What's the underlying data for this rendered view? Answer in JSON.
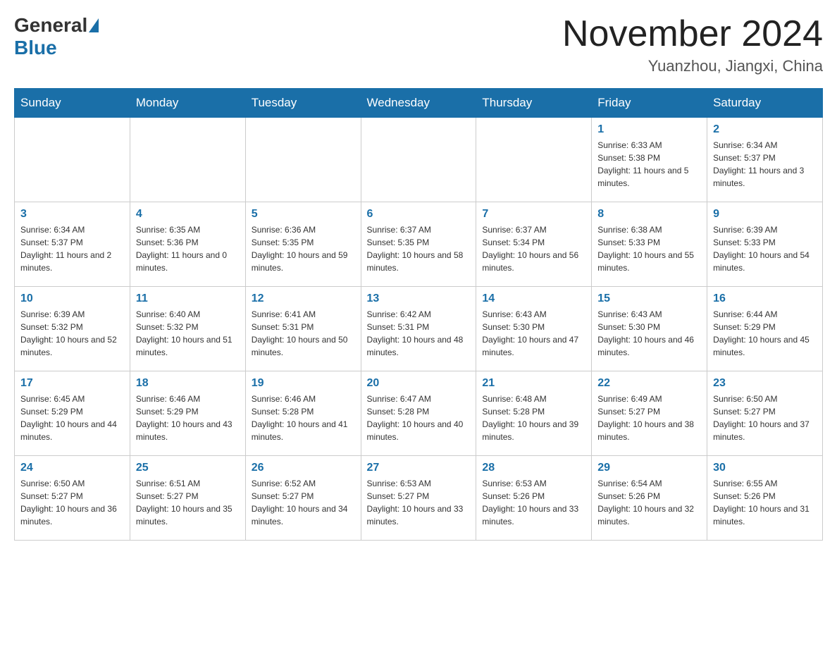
{
  "header": {
    "logo_general": "General",
    "logo_blue": "Blue",
    "month_title": "November 2024",
    "location": "Yuanzhou, Jiangxi, China"
  },
  "days_of_week": [
    "Sunday",
    "Monday",
    "Tuesday",
    "Wednesday",
    "Thursday",
    "Friday",
    "Saturday"
  ],
  "weeks": [
    [
      {
        "day": "",
        "info": ""
      },
      {
        "day": "",
        "info": ""
      },
      {
        "day": "",
        "info": ""
      },
      {
        "day": "",
        "info": ""
      },
      {
        "day": "",
        "info": ""
      },
      {
        "day": "1",
        "info": "Sunrise: 6:33 AM\nSunset: 5:38 PM\nDaylight: 11 hours and 5 minutes."
      },
      {
        "day": "2",
        "info": "Sunrise: 6:34 AM\nSunset: 5:37 PM\nDaylight: 11 hours and 3 minutes."
      }
    ],
    [
      {
        "day": "3",
        "info": "Sunrise: 6:34 AM\nSunset: 5:37 PM\nDaylight: 11 hours and 2 minutes."
      },
      {
        "day": "4",
        "info": "Sunrise: 6:35 AM\nSunset: 5:36 PM\nDaylight: 11 hours and 0 minutes."
      },
      {
        "day": "5",
        "info": "Sunrise: 6:36 AM\nSunset: 5:35 PM\nDaylight: 10 hours and 59 minutes."
      },
      {
        "day": "6",
        "info": "Sunrise: 6:37 AM\nSunset: 5:35 PM\nDaylight: 10 hours and 58 minutes."
      },
      {
        "day": "7",
        "info": "Sunrise: 6:37 AM\nSunset: 5:34 PM\nDaylight: 10 hours and 56 minutes."
      },
      {
        "day": "8",
        "info": "Sunrise: 6:38 AM\nSunset: 5:33 PM\nDaylight: 10 hours and 55 minutes."
      },
      {
        "day": "9",
        "info": "Sunrise: 6:39 AM\nSunset: 5:33 PM\nDaylight: 10 hours and 54 minutes."
      }
    ],
    [
      {
        "day": "10",
        "info": "Sunrise: 6:39 AM\nSunset: 5:32 PM\nDaylight: 10 hours and 52 minutes."
      },
      {
        "day": "11",
        "info": "Sunrise: 6:40 AM\nSunset: 5:32 PM\nDaylight: 10 hours and 51 minutes."
      },
      {
        "day": "12",
        "info": "Sunrise: 6:41 AM\nSunset: 5:31 PM\nDaylight: 10 hours and 50 minutes."
      },
      {
        "day": "13",
        "info": "Sunrise: 6:42 AM\nSunset: 5:31 PM\nDaylight: 10 hours and 48 minutes."
      },
      {
        "day": "14",
        "info": "Sunrise: 6:43 AM\nSunset: 5:30 PM\nDaylight: 10 hours and 47 minutes."
      },
      {
        "day": "15",
        "info": "Sunrise: 6:43 AM\nSunset: 5:30 PM\nDaylight: 10 hours and 46 minutes."
      },
      {
        "day": "16",
        "info": "Sunrise: 6:44 AM\nSunset: 5:29 PM\nDaylight: 10 hours and 45 minutes."
      }
    ],
    [
      {
        "day": "17",
        "info": "Sunrise: 6:45 AM\nSunset: 5:29 PM\nDaylight: 10 hours and 44 minutes."
      },
      {
        "day": "18",
        "info": "Sunrise: 6:46 AM\nSunset: 5:29 PM\nDaylight: 10 hours and 43 minutes."
      },
      {
        "day": "19",
        "info": "Sunrise: 6:46 AM\nSunset: 5:28 PM\nDaylight: 10 hours and 41 minutes."
      },
      {
        "day": "20",
        "info": "Sunrise: 6:47 AM\nSunset: 5:28 PM\nDaylight: 10 hours and 40 minutes."
      },
      {
        "day": "21",
        "info": "Sunrise: 6:48 AM\nSunset: 5:28 PM\nDaylight: 10 hours and 39 minutes."
      },
      {
        "day": "22",
        "info": "Sunrise: 6:49 AM\nSunset: 5:27 PM\nDaylight: 10 hours and 38 minutes."
      },
      {
        "day": "23",
        "info": "Sunrise: 6:50 AM\nSunset: 5:27 PM\nDaylight: 10 hours and 37 minutes."
      }
    ],
    [
      {
        "day": "24",
        "info": "Sunrise: 6:50 AM\nSunset: 5:27 PM\nDaylight: 10 hours and 36 minutes."
      },
      {
        "day": "25",
        "info": "Sunrise: 6:51 AM\nSunset: 5:27 PM\nDaylight: 10 hours and 35 minutes."
      },
      {
        "day": "26",
        "info": "Sunrise: 6:52 AM\nSunset: 5:27 PM\nDaylight: 10 hours and 34 minutes."
      },
      {
        "day": "27",
        "info": "Sunrise: 6:53 AM\nSunset: 5:27 PM\nDaylight: 10 hours and 33 minutes."
      },
      {
        "day": "28",
        "info": "Sunrise: 6:53 AM\nSunset: 5:26 PM\nDaylight: 10 hours and 33 minutes."
      },
      {
        "day": "29",
        "info": "Sunrise: 6:54 AM\nSunset: 5:26 PM\nDaylight: 10 hours and 32 minutes."
      },
      {
        "day": "30",
        "info": "Sunrise: 6:55 AM\nSunset: 5:26 PM\nDaylight: 10 hours and 31 minutes."
      }
    ]
  ]
}
